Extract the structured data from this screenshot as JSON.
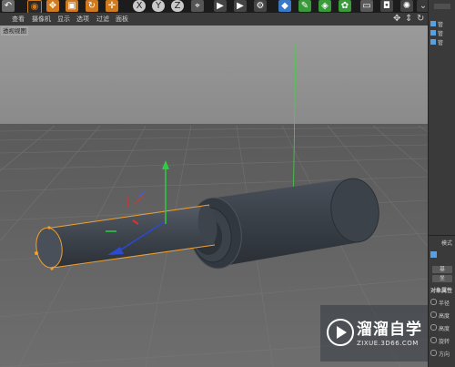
{
  "menubar": {
    "items": [
      "查看",
      "摄像机",
      "显示",
      "选项",
      "过滤",
      "面板"
    ]
  },
  "viewport": {
    "label": "透视视图"
  },
  "right_panel": {
    "object_items": [
      "管",
      "管",
      "管"
    ],
    "mode_label": "模式",
    "buttons": [
      "基",
      "坐"
    ],
    "section_title": "对象属性",
    "params": [
      "半径",
      "高度",
      "高度",
      "旋转",
      "方向"
    ]
  },
  "watermark": {
    "title": "溜溜自学",
    "url": "ZIXUE.3D66.COM"
  },
  "colors": {
    "toolbar_bg": "#1c1c1c",
    "menubar_bg": "#3a3a3a",
    "viewport_bg": "#8e8e8e",
    "grid": "#6a6a6a",
    "selection": "#f0a030",
    "axis_y": "#2ecc40",
    "axis_x": "#e0302a",
    "axis_z": "#2a4ad0"
  }
}
